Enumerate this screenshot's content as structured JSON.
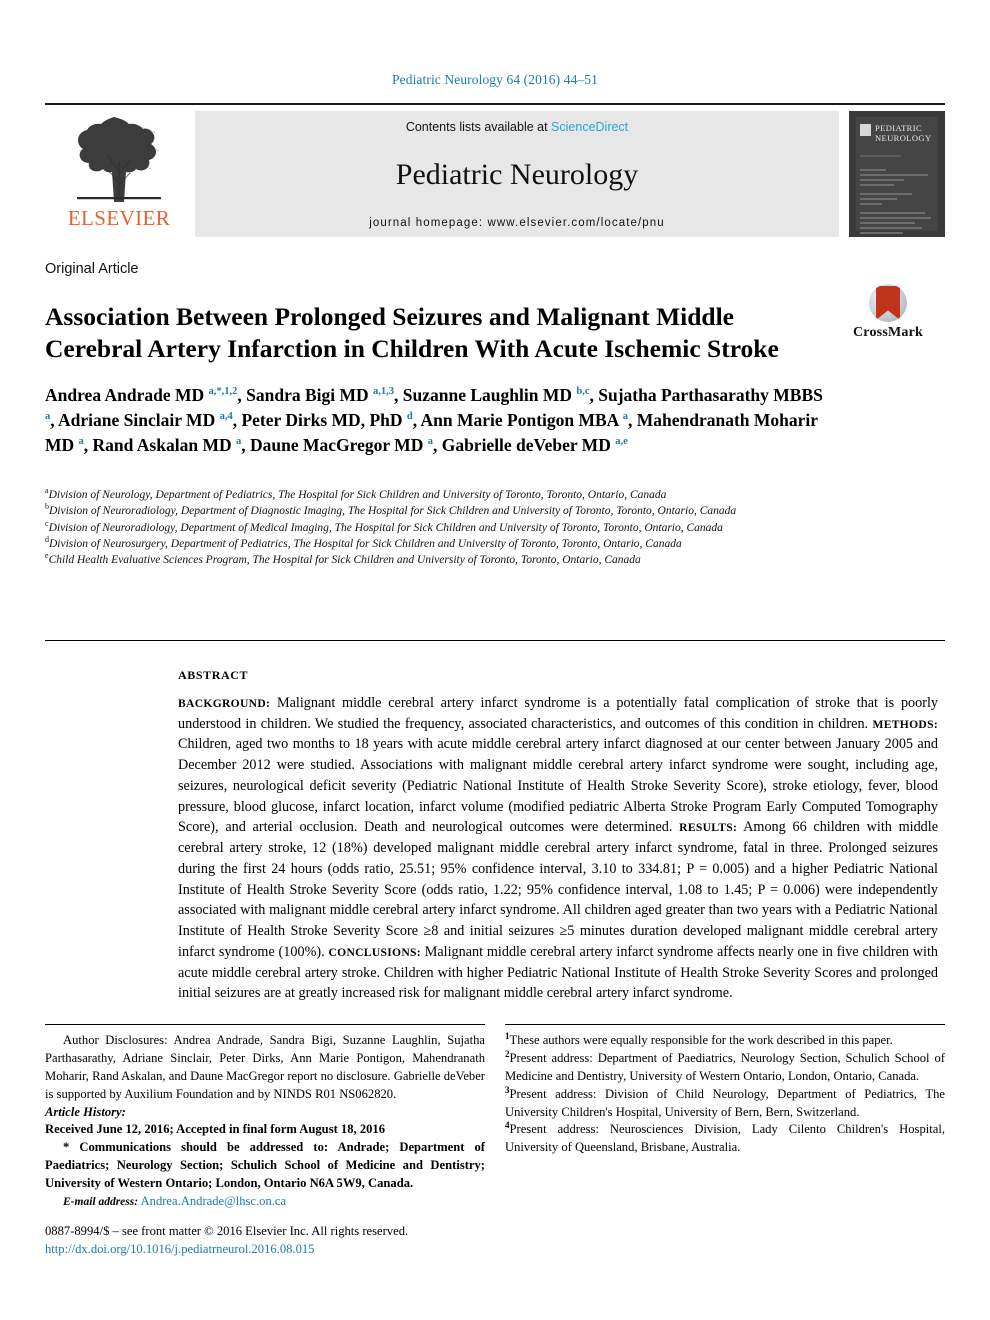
{
  "running_head": "Pediatric Neurology 64 (2016) 44–51",
  "masthead": {
    "publisher_logo_text": "ELSEVIER",
    "contents_prefix": "Contents lists available at ",
    "contents_link": "ScienceDirect",
    "journal_name": "Pediatric Neurology",
    "homepage_line": "journal homepage: www.elsevier.com/locate/pnu",
    "cover_title_line1": "PEDIATRIC",
    "cover_title_line2": "NEUROLOGY"
  },
  "article": {
    "type": "Original Article",
    "title": "Association Between Prolonged Seizures and Malignant Middle Cerebral Artery Infarction in Children With Acute Ischemic Stroke",
    "crossmark_label": "CrossMark"
  },
  "authors_html": "Andrea Andrade MD <sup>a,<span class=\"star\">*</span>,1,2</sup>, Sandra Bigi MD <sup>a,1,3</sup>, Suzanne Laughlin MD <sup>b,c</sup>, Sujatha Parthasarathy MBBS <sup>a</sup>, Adriane Sinclair MD <sup>a,4</sup>, Peter Dirks MD, PhD <sup>d</sup>, Ann Marie Pontigon MBA <sup>a</sup>, Mahendranath Moharir MD <sup>a</sup>, Rand Askalan MD <sup>a</sup>, Daune MacGregor MD <sup>a</sup>, Gabrielle deVeber MD <sup>a,e</sup>",
  "affiliations": [
    {
      "marker": "a",
      "text": "Division of Neurology, Department of Pediatrics, The Hospital for Sick Children and University of Toronto, Toronto, Ontario, Canada"
    },
    {
      "marker": "b",
      "text": "Division of Neuroradiology, Department of Diagnostic Imaging, The Hospital for Sick Children and University of Toronto, Toronto, Ontario, Canada"
    },
    {
      "marker": "c",
      "text": "Division of Neuroradiology, Department of Medical Imaging, The Hospital for Sick Children and University of Toronto, Toronto, Ontario, Canada"
    },
    {
      "marker": "d",
      "text": "Division of Neurosurgery, Department of Pediatrics, The Hospital for Sick Children and University of Toronto, Toronto, Ontario, Canada"
    },
    {
      "marker": "e",
      "text": "Child Health Evaluative Sciences Program, The Hospital for Sick Children and University of Toronto, Toronto, Ontario, Canada"
    }
  ],
  "abstract": {
    "label": "ABSTRACT",
    "sections": [
      {
        "heading": "BACKGROUND:",
        "text": " Malignant middle cerebral artery infarct syndrome is a potentially fatal complication of stroke that is poorly understood in children. We studied the frequency, associated characteristics, and outcomes of this condition in children. "
      },
      {
        "heading": "METHODS:",
        "text": " Children, aged two months to 18 years with acute middle cerebral artery infarct diagnosed at our center between January 2005 and December 2012 were studied. Associations with malignant middle cerebral artery infarct syndrome were sought, including age, seizures, neurological deficit severity (Pediatric National Institute of Health Stroke Severity Score), stroke etiology, fever, blood pressure, blood glucose, infarct location, infarct volume (modified pediatric Alberta Stroke Program Early Computed Tomography Score), and arterial occlusion. Death and neurological outcomes were determined. "
      },
      {
        "heading": "RESULTS:",
        "text": " Among 66 children with middle cerebral artery stroke, 12 (18%) developed malignant middle cerebral artery infarct syndrome, fatal in three. Prolonged seizures during the first 24 hours (odds ratio, 25.51; 95% confidence interval, 3.10 to 334.81; P = 0.005) and a higher Pediatric National Institute of Health Stroke Severity Score (odds ratio, 1.22; 95% confidence interval, 1.08 to 1.45; P = 0.006) were independently associated with malignant middle cerebral artery infarct syndrome. All children aged greater than two years with a Pediatric National Institute of Health Stroke Severity Score ≥8 and initial seizures ≥5 minutes duration developed malignant middle cerebral artery infarct syndrome (100%). "
      },
      {
        "heading": "CONCLUSIONS:",
        "text": " Malignant middle cerebral artery infarct syndrome affects nearly one in five children with acute middle cerebral artery stroke. Children with higher Pediatric National Institute of Health Stroke Severity Scores and prolonged initial seizures are at greatly increased risk for malignant middle cerebral artery infarct syndrome."
      }
    ]
  },
  "footer_left": {
    "disclosures": "Author Disclosures: Andrea Andrade, Sandra Bigi, Suzanne Laughlin, Sujatha Parthasarathy, Adriane Sinclair, Peter Dirks, Ann Marie Pontigon, Mahendranath Moharir, Rand Askalan, and Daune MacGregor report no disclosure. Gabrielle deVeber is supported by Auxilium Foundation and by NINDS R01 NS062820.",
    "history_label": "Article History:",
    "history": "Received June 12, 2016; Accepted in final form August 18, 2016",
    "correspondence": "* Communications should be addressed to: Andrade; Department of Paediatrics; Neurology Section; Schulich School of Medicine and Dentistry; University of Western Ontario; London, Ontario N6A 5W9, Canada.",
    "email_label": "E-mail address:",
    "email_value": "Andrea.Andrade@lhsc.on.ca"
  },
  "footer_right": {
    "notes": [
      {
        "marker": "1",
        "text": "These authors were equally responsible for the work described in this paper."
      },
      {
        "marker": "2",
        "text": "Present address: Department of Paediatrics, Neurology Section, Schulich School of Medicine and Dentistry, University of Western Ontario, London, Ontario, Canada."
      },
      {
        "marker": "3",
        "text": "Present address: Division of Child Neurology, Department of Pediatrics, The University Children's Hospital, University of Bern, Bern, Switzerland."
      },
      {
        "marker": "4",
        "text": "Present address: Neurosciences Division, Lady Cilento Children's Hospital, University of Queensland, Brisbane, Australia."
      }
    ]
  },
  "copyright": {
    "line": "0887-8994/$ – see front matter © 2016 Elsevier Inc. All rights reserved.",
    "doi": "http://dx.doi.org/10.1016/j.pediatrneurol.2016.08.015"
  },
  "colors": {
    "link": "#1a7bb0",
    "sciencedirect": "#2aa3d8",
    "elsevier_orange": "#E8622B",
    "band_gray": "#e7e7e7"
  }
}
